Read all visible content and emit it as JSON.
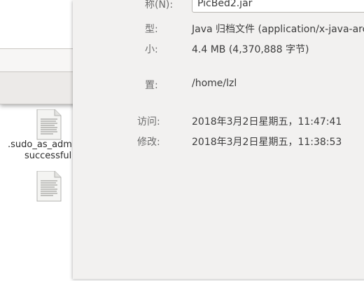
{
  "properties": {
    "name_label": "称(N):",
    "name_value": "PicBed2.jar",
    "type_label": "型:",
    "type_value": "Java 归档文件 (application/x-java-archive)",
    "size_label": "小:",
    "size_value": "4.4 MB (4,370,888 字节)",
    "location_label": "置:",
    "location_value": "/home/lzl",
    "accessed_label": "访问:",
    "accessed_value": "2018年3月2日星期五，11:47:41",
    "modified_label": "修改:",
    "modified_value": "2018年3月2日星期五，11:38:53"
  },
  "desktop": {
    "file1_caption_line1": ".sudo_as_adm",
    "file1_caption_line2": "successful"
  },
  "icons": {
    "file1": "text-file-icon",
    "file2": "text-file-icon"
  }
}
